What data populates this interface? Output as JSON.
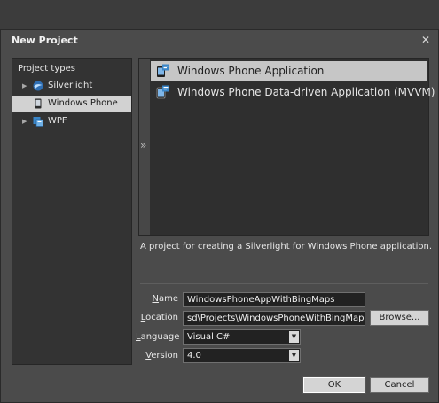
{
  "dialog": {
    "title": "New Project",
    "close_icon": "close-icon"
  },
  "project_types": {
    "heading": "Project types",
    "items": [
      {
        "label": "Silverlight",
        "icon": "silverlight-icon",
        "expandable": true,
        "selected": false
      },
      {
        "label": "Windows Phone",
        "icon": "phone-icon",
        "expandable": false,
        "selected": true
      },
      {
        "label": "WPF",
        "icon": "wpf-icon",
        "expandable": true,
        "selected": false
      }
    ]
  },
  "templates": {
    "collapse_glyph": "»",
    "items": [
      {
        "label": "Windows Phone Application",
        "icon": "phone-app-icon",
        "selected": true
      },
      {
        "label": "Windows Phone Data-driven Application (MVVM)",
        "icon": "phone-app-icon",
        "selected": false
      }
    ]
  },
  "description": "A project for creating a Silverlight for Windows Phone application.",
  "form": {
    "name": {
      "label_accel": "N",
      "label_rest": "ame",
      "value": "WindowsPhoneAppWithBingMaps"
    },
    "location": {
      "label_accel": "L",
      "label_rest": "ocation",
      "value": "sd\\Projects\\WindowsPhoneWithBingMaps\\"
    },
    "language": {
      "label_accel": "L",
      "label_rest": "anguage",
      "value": "Visual C#"
    },
    "version": {
      "label_accel": "V",
      "label_rest": "ersion",
      "value": "4.0"
    }
  },
  "buttons": {
    "browse": "Browse...",
    "ok": "OK",
    "cancel": "Cancel"
  },
  "colors": {
    "dialog_bg": "#4b4b4b",
    "panel_bg": "#333333",
    "selection": "#d2d2d2",
    "accent_blue": "#3a86c8"
  }
}
